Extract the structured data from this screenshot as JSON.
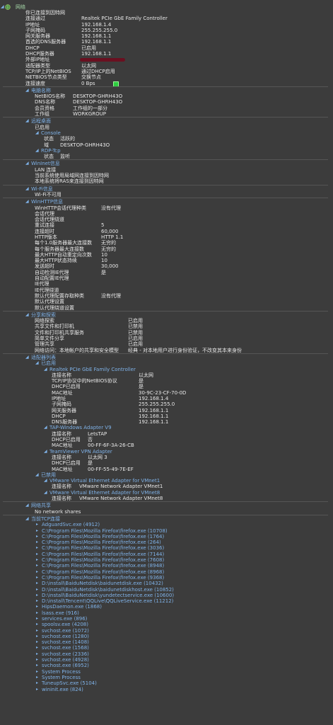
{
  "root": {
    "label": "网络"
  },
  "network": [
    {
      "k": "你已连接到因特网",
      "v": ""
    },
    {
      "k": "连接通过",
      "v": "Realtek PCIe GbE Family Controller"
    },
    {
      "k": "IP地址",
      "v": "192.168.1.4"
    },
    {
      "k": "子网掩码",
      "v": "255.255.255.0"
    },
    {
      "k": "网关服务器",
      "v": "192.168.1.1"
    },
    {
      "k": "首选的DNS服务器",
      "v": "192.168.1.1"
    },
    {
      "k": "DHCP",
      "v": "已启用"
    },
    {
      "k": "DHCP服务器",
      "v": "192.168.1.1"
    },
    {
      "k": "外部IP地址",
      "v": ""
    },
    {
      "k": "适配器类型",
      "v": "以太网"
    },
    {
      "k": "TCP/IP上的NetBIOS",
      "v": "通过DHCP启用"
    },
    {
      "k": "NETBIOS节点类型",
      "v": "交换节点"
    },
    {
      "k": "连接速度",
      "v": "0 Bps"
    }
  ],
  "computer_name": {
    "title": "电脑名称",
    "rows": [
      {
        "k": "NetBIOS名称",
        "v": "DESKTOP-GHRH43O"
      },
      {
        "k": "DNS名称",
        "v": "DESKTOP-GHRH43O"
      },
      {
        "k": "会员资格",
        "v": "工作组的一部分"
      },
      {
        "k": "工作组",
        "v": "WORKGROUP"
      }
    ]
  },
  "remote_desktop": {
    "title": "远程桌面",
    "status": "已启用",
    "console": {
      "title": "Console",
      "rows": [
        {
          "k": "状态",
          "v": "活跃的"
        },
        {
          "k": "域",
          "v": "DESKTOP-GHRH43O"
        }
      ]
    },
    "rdp": {
      "title": "RDP-Tcp",
      "rows": [
        {
          "k": "状态",
          "v": "监听"
        }
      ]
    }
  },
  "wininet": {
    "title": "WinInet信息",
    "lines": [
      "LAN 连接",
      "当前系统使用局域网连接到因特网",
      "本地系统将RAS来连接到因特网"
    ]
  },
  "wifi": {
    "title": "Wi-Fi信息",
    "lines": [
      "Wi-Fi不可用"
    ]
  },
  "winhttp": {
    "title": "WinHTTP信息",
    "rows": [
      {
        "k": "WinHTTP会话代理种类",
        "v": "没有代理"
      },
      {
        "k": "会话代理",
        "v": ""
      },
      {
        "k": "会话代理绕道",
        "v": ""
      },
      {
        "k": "重试连接",
        "v": "5"
      },
      {
        "k": "连接超时",
        "v": "60,000"
      },
      {
        "k": "HTTP版本",
        "v": "HTTP 1.1"
      },
      {
        "k": "每个1.0服务器最大连接数",
        "v": "无穷的"
      },
      {
        "k": "每个服务器最大连接数",
        "v": "无穷的"
      },
      {
        "k": "最大HTTP自动重定向次数",
        "v": "10"
      },
      {
        "k": "最大HTTP状态持续",
        "v": "10"
      },
      {
        "k": "发送超时",
        "v": "30,000"
      },
      {
        "k": "自动检测IE代理",
        "v": "是"
      },
      {
        "k": "自动配置IE代理",
        "v": ""
      },
      {
        "k": "IE代理",
        "v": ""
      },
      {
        "k": "IE代理绕道",
        "v": ""
      },
      {
        "k": "默认代理配置存取种类",
        "v": "没有代理"
      },
      {
        "k": "默认代理设置",
        "v": ""
      },
      {
        "k": "默认代理绕道设置",
        "v": ""
      }
    ]
  },
  "sharing": {
    "title": "分享和探索",
    "rows": [
      {
        "k": "网络探索",
        "v": "已启用"
      },
      {
        "k": "共享文件和打印机",
        "v": "已禁用"
      },
      {
        "k": "文件和打印机共享服务",
        "v": "已禁用"
      },
      {
        "k": "简单文件分享",
        "v": "已启用"
      },
      {
        "k": "管理共享",
        "v": "已启用"
      },
      {
        "k": "网络访问：本地帐户的共享和安全模型",
        "v": "经典 - 对本地用户进行身份验证，不改变其本来身份"
      }
    ]
  },
  "adapters": {
    "title": "适配器列表",
    "enabled_title": "已启用",
    "realtek": {
      "title": "Realtek PCIe GbE Family Controller",
      "rows": [
        {
          "k": "连接名称",
          "v": "以太网"
        },
        {
          "k": "TCP/IP协议中的NetBIOS协议",
          "v": "是"
        },
        {
          "k": "DHCP已启用",
          "v": "是"
        },
        {
          "k": "MAC地址",
          "v": "30-9C-23-CF-70-0D"
        },
        {
          "k": "IP地址",
          "v": "192.168.1.4"
        },
        {
          "k": "子网掩码",
          "v": "255.255.255.0"
        },
        {
          "k": "网关服务器",
          "v": "192.168.1.1"
        },
        {
          "k": "DHCP",
          "v": "192.168.1.1"
        },
        {
          "k": "DNS服务器",
          "v": "192.168.1.1"
        }
      ]
    },
    "tap": {
      "title": "TAP-Windows Adapter V9",
      "rows": [
        {
          "k": "连接名称",
          "v": "LetsTAP"
        },
        {
          "k": "DHCP已启用",
          "v": "否"
        },
        {
          "k": "MAC地址",
          "v": "00-FF-6F-3A-26-CB"
        }
      ]
    },
    "teamviewer": {
      "title": "TeamViewer VPN Adapter",
      "rows": [
        {
          "k": "连接名称",
          "v": "以太网 3"
        },
        {
          "k": "DHCP已启用",
          "v": "是"
        },
        {
          "k": "MAC地址",
          "v": "00-FF-55-49-7E-EF"
        }
      ]
    },
    "disabled_title": "已禁用",
    "vm1": {
      "title": "VMware Virtual Ethernet Adapter for VMnet1",
      "rows": [
        {
          "k": "连接名称",
          "v": "VMware Network Adapter VMnet1"
        }
      ]
    },
    "vm8": {
      "title": "VMware Virtual Ethernet Adapter for VMnet8",
      "rows": [
        {
          "k": "连接名称",
          "v": "VMware Network Adapter VMnet8"
        }
      ]
    }
  },
  "shares": {
    "title": "网络共享",
    "lines": [
      "No network shares"
    ]
  },
  "tcp": {
    "title": "当前TCP连接",
    "items": [
      "AdguardSvc.exe (4912)",
      "C:\\Program Files\\Mozilla Firefox\\firefox.exe (10708)",
      "C:\\Program Files\\Mozilla Firefox\\firefox.exe (1764)",
      "C:\\Program Files\\Mozilla Firefox\\firefox.exe (264)",
      "C:\\Program Files\\Mozilla Firefox\\firefox.exe (3036)",
      "C:\\Program Files\\Mozilla Firefox\\firefox.exe (7144)",
      "C:\\Program Files\\Mozilla Firefox\\firefox.exe (7608)",
      "C:\\Program Files\\Mozilla Firefox\\firefox.exe (8948)",
      "C:\\Program Files\\Mozilla Firefox\\firefox.exe (8968)",
      "C:\\Program Files\\Mozilla Firefox\\firefox.exe (9368)",
      "D:\\install\\BaiduNetdisk\\baidunetdisk.exe (10432)",
      "D:\\install\\BaiduNetdisk\\baidunetdiskhost.exe (10852)",
      "D:\\install\\BaiduNetdisk\\yundetectservice.exe (10600)",
      "D:\\install\\Tencent\\QQLive\\QQLiveService.exe (11212)",
      "HipsDaemon.exe (1868)",
      "lsass.exe (916)",
      "services.exe (896)",
      "spoolsv.exe (4208)",
      "svchost.exe (1072)",
      "svchost.exe (1280)",
      "svchost.exe (1408)",
      "svchost.exe (1568)",
      "svchost.exe (2336)",
      "svchost.exe (4928)",
      "svchost.exe (6952)",
      "System Process",
      "System Process",
      "TuneupSvc.exe (5104)",
      "wininit.exe (824)"
    ]
  },
  "colors": {
    "background": "#3c3c3c",
    "text": "#e8e8e8",
    "header": "#7fb2e8",
    "status_ok": "#2ecc40"
  }
}
